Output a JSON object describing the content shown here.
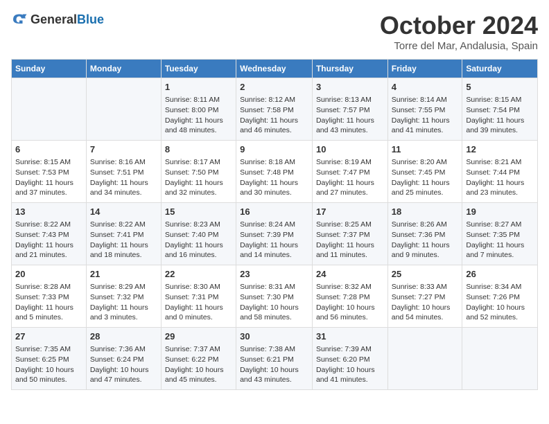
{
  "header": {
    "logo_general": "General",
    "logo_blue": "Blue",
    "month_title": "October 2024",
    "location": "Torre del Mar, Andalusia, Spain"
  },
  "weekdays": [
    "Sunday",
    "Monday",
    "Tuesday",
    "Wednesday",
    "Thursday",
    "Friday",
    "Saturday"
  ],
  "weeks": [
    [
      {
        "day": "",
        "sunrise": "",
        "sunset": "",
        "daylight": ""
      },
      {
        "day": "",
        "sunrise": "",
        "sunset": "",
        "daylight": ""
      },
      {
        "day": "1",
        "sunrise": "Sunrise: 8:11 AM",
        "sunset": "Sunset: 8:00 PM",
        "daylight": "Daylight: 11 hours and 48 minutes."
      },
      {
        "day": "2",
        "sunrise": "Sunrise: 8:12 AM",
        "sunset": "Sunset: 7:58 PM",
        "daylight": "Daylight: 11 hours and 46 minutes."
      },
      {
        "day": "3",
        "sunrise": "Sunrise: 8:13 AM",
        "sunset": "Sunset: 7:57 PM",
        "daylight": "Daylight: 11 hours and 43 minutes."
      },
      {
        "day": "4",
        "sunrise": "Sunrise: 8:14 AM",
        "sunset": "Sunset: 7:55 PM",
        "daylight": "Daylight: 11 hours and 41 minutes."
      },
      {
        "day": "5",
        "sunrise": "Sunrise: 8:15 AM",
        "sunset": "Sunset: 7:54 PM",
        "daylight": "Daylight: 11 hours and 39 minutes."
      }
    ],
    [
      {
        "day": "6",
        "sunrise": "Sunrise: 8:15 AM",
        "sunset": "Sunset: 7:53 PM",
        "daylight": "Daylight: 11 hours and 37 minutes."
      },
      {
        "day": "7",
        "sunrise": "Sunrise: 8:16 AM",
        "sunset": "Sunset: 7:51 PM",
        "daylight": "Daylight: 11 hours and 34 minutes."
      },
      {
        "day": "8",
        "sunrise": "Sunrise: 8:17 AM",
        "sunset": "Sunset: 7:50 PM",
        "daylight": "Daylight: 11 hours and 32 minutes."
      },
      {
        "day": "9",
        "sunrise": "Sunrise: 8:18 AM",
        "sunset": "Sunset: 7:48 PM",
        "daylight": "Daylight: 11 hours and 30 minutes."
      },
      {
        "day": "10",
        "sunrise": "Sunrise: 8:19 AM",
        "sunset": "Sunset: 7:47 PM",
        "daylight": "Daylight: 11 hours and 27 minutes."
      },
      {
        "day": "11",
        "sunrise": "Sunrise: 8:20 AM",
        "sunset": "Sunset: 7:45 PM",
        "daylight": "Daylight: 11 hours and 25 minutes."
      },
      {
        "day": "12",
        "sunrise": "Sunrise: 8:21 AM",
        "sunset": "Sunset: 7:44 PM",
        "daylight": "Daylight: 11 hours and 23 minutes."
      }
    ],
    [
      {
        "day": "13",
        "sunrise": "Sunrise: 8:22 AM",
        "sunset": "Sunset: 7:43 PM",
        "daylight": "Daylight: 11 hours and 21 minutes."
      },
      {
        "day": "14",
        "sunrise": "Sunrise: 8:22 AM",
        "sunset": "Sunset: 7:41 PM",
        "daylight": "Daylight: 11 hours and 18 minutes."
      },
      {
        "day": "15",
        "sunrise": "Sunrise: 8:23 AM",
        "sunset": "Sunset: 7:40 PM",
        "daylight": "Daylight: 11 hours and 16 minutes."
      },
      {
        "day": "16",
        "sunrise": "Sunrise: 8:24 AM",
        "sunset": "Sunset: 7:39 PM",
        "daylight": "Daylight: 11 hours and 14 minutes."
      },
      {
        "day": "17",
        "sunrise": "Sunrise: 8:25 AM",
        "sunset": "Sunset: 7:37 PM",
        "daylight": "Daylight: 11 hours and 11 minutes."
      },
      {
        "day": "18",
        "sunrise": "Sunrise: 8:26 AM",
        "sunset": "Sunset: 7:36 PM",
        "daylight": "Daylight: 11 hours and 9 minutes."
      },
      {
        "day": "19",
        "sunrise": "Sunrise: 8:27 AM",
        "sunset": "Sunset: 7:35 PM",
        "daylight": "Daylight: 11 hours and 7 minutes."
      }
    ],
    [
      {
        "day": "20",
        "sunrise": "Sunrise: 8:28 AM",
        "sunset": "Sunset: 7:33 PM",
        "daylight": "Daylight: 11 hours and 5 minutes."
      },
      {
        "day": "21",
        "sunrise": "Sunrise: 8:29 AM",
        "sunset": "Sunset: 7:32 PM",
        "daylight": "Daylight: 11 hours and 3 minutes."
      },
      {
        "day": "22",
        "sunrise": "Sunrise: 8:30 AM",
        "sunset": "Sunset: 7:31 PM",
        "daylight": "Daylight: 11 hours and 0 minutes."
      },
      {
        "day": "23",
        "sunrise": "Sunrise: 8:31 AM",
        "sunset": "Sunset: 7:30 PM",
        "daylight": "Daylight: 10 hours and 58 minutes."
      },
      {
        "day": "24",
        "sunrise": "Sunrise: 8:32 AM",
        "sunset": "Sunset: 7:28 PM",
        "daylight": "Daylight: 10 hours and 56 minutes."
      },
      {
        "day": "25",
        "sunrise": "Sunrise: 8:33 AM",
        "sunset": "Sunset: 7:27 PM",
        "daylight": "Daylight: 10 hours and 54 minutes."
      },
      {
        "day": "26",
        "sunrise": "Sunrise: 8:34 AM",
        "sunset": "Sunset: 7:26 PM",
        "daylight": "Daylight: 10 hours and 52 minutes."
      }
    ],
    [
      {
        "day": "27",
        "sunrise": "Sunrise: 7:35 AM",
        "sunset": "Sunset: 6:25 PM",
        "daylight": "Daylight: 10 hours and 50 minutes."
      },
      {
        "day": "28",
        "sunrise": "Sunrise: 7:36 AM",
        "sunset": "Sunset: 6:24 PM",
        "daylight": "Daylight: 10 hours and 47 minutes."
      },
      {
        "day": "29",
        "sunrise": "Sunrise: 7:37 AM",
        "sunset": "Sunset: 6:22 PM",
        "daylight": "Daylight: 10 hours and 45 minutes."
      },
      {
        "day": "30",
        "sunrise": "Sunrise: 7:38 AM",
        "sunset": "Sunset: 6:21 PM",
        "daylight": "Daylight: 10 hours and 43 minutes."
      },
      {
        "day": "31",
        "sunrise": "Sunrise: 7:39 AM",
        "sunset": "Sunset: 6:20 PM",
        "daylight": "Daylight: 10 hours and 41 minutes."
      },
      {
        "day": "",
        "sunrise": "",
        "sunset": "",
        "daylight": ""
      },
      {
        "day": "",
        "sunrise": "",
        "sunset": "",
        "daylight": ""
      }
    ]
  ]
}
